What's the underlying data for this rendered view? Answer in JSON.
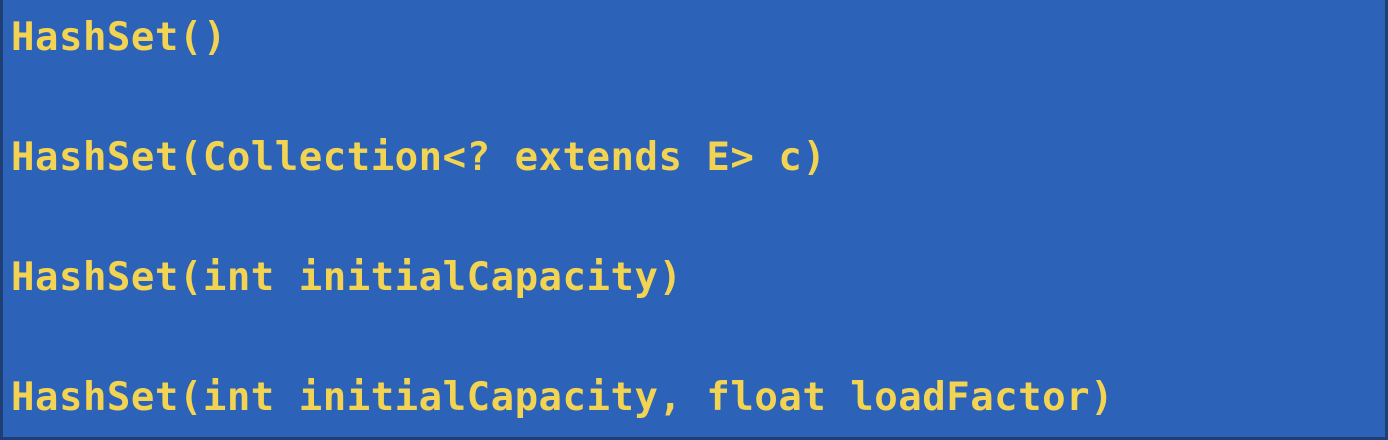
{
  "colors": {
    "background": "#2c63b8",
    "text": "#f2d452"
  },
  "constructors": [
    "HashSet()",
    "HashSet(Collection<? extends E> c)",
    "HashSet(int initialCapacity)",
    "HashSet(int initialCapacity, float loadFactor)"
  ]
}
